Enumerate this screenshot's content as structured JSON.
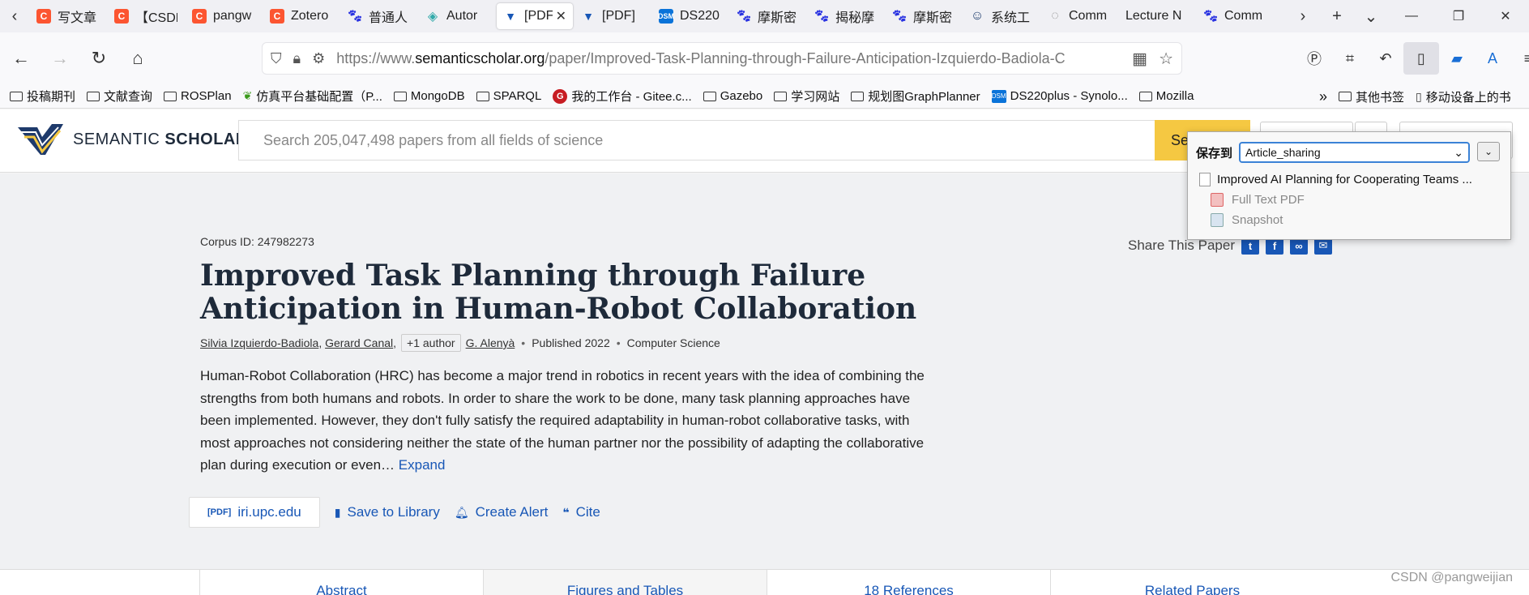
{
  "browser": {
    "tabs": [
      {
        "label": "写文章",
        "icon": "csdn-icon",
        "active": false
      },
      {
        "label": "【CSDN",
        "icon": "csdn-icon",
        "active": false
      },
      {
        "label": "pangw",
        "icon": "csdn-icon",
        "active": false
      },
      {
        "label": "Zotero",
        "icon": "csdn-icon",
        "active": false
      },
      {
        "label": "普通人",
        "icon": "baidu-paw-icon",
        "active": false
      },
      {
        "label": "Autor",
        "icon": "autor-icon",
        "active": false
      },
      {
        "label": "[PDF",
        "icon": "semantic-scholar-icon",
        "active": true
      },
      {
        "label": "[PDF]",
        "icon": "semantic-scholar-icon",
        "active": false
      },
      {
        "label": "DS220",
        "icon": "dsm-icon",
        "active": false
      },
      {
        "label": "摩斯密",
        "icon": "baidu-paw-icon",
        "active": false
      },
      {
        "label": "揭秘摩",
        "icon": "baidu-paw-icon",
        "active": false
      },
      {
        "label": "摩斯密",
        "icon": "baidu-paw-icon",
        "active": false
      },
      {
        "label": "系统工",
        "icon": "system-icon",
        "active": false
      },
      {
        "label": "Comm",
        "icon": "doc-icon",
        "active": false
      },
      {
        "label": "Lecture N",
        "icon": "",
        "active": false
      },
      {
        "label": "Comm",
        "icon": "baidu-paw-icon",
        "active": false
      }
    ],
    "url": {
      "prefix": "https://www.",
      "host": "semanticscholar.org",
      "path": "/paper/Improved-Task-Planning-through-Failure-Anticipation-Izquierdo-Badiola-C"
    },
    "bookmarks": [
      {
        "label": "投稿期刊",
        "icon": "folder"
      },
      {
        "label": "文献查询",
        "icon": "folder"
      },
      {
        "label": "ROSPlan",
        "icon": "folder"
      },
      {
        "label": "仿真平台基础配置（P...",
        "icon": "leaf"
      },
      {
        "label": "MongoDB",
        "icon": "folder"
      },
      {
        "label": "SPARQL",
        "icon": "folder"
      },
      {
        "label": "我的工作台 - Gitee.c...",
        "icon": "gitee"
      },
      {
        "label": "Gazebo",
        "icon": "folder"
      },
      {
        "label": "学习网站",
        "icon": "folder"
      },
      {
        "label": "规划图GraphPlanner",
        "icon": "folder"
      },
      {
        "label": "DS220plus - Synolo...",
        "icon": "dsm"
      },
      {
        "label": "Mozilla",
        "icon": "folder"
      }
    ],
    "bookmarks_overflow": [
      {
        "label": "其他书签",
        "icon": "folder"
      },
      {
        "label": "移动设备上的书",
        "icon": "mobile"
      }
    ]
  },
  "site": {
    "brand_light": "SEMANTIC ",
    "brand_bold": "SCHOLAR",
    "search_placeholder": "Search 205,047,498 papers from all fields of science",
    "search_button": "Se"
  },
  "paper": {
    "corpus_id": "Corpus ID: 247982273",
    "title": "Improved Task Planning through Failure Anticipation in Human-Robot Collaboration",
    "authors": [
      "Silvia Izquierdo-Badiola",
      "Gerard Canal"
    ],
    "more_authors": "+1 author",
    "last_author": "G. Alenyà",
    "published": "Published 2022",
    "field": "Computer Science",
    "abstract": "Human-Robot Collaboration (HRC) has become a major trend in robotics in recent years with the idea of combining the strengths from both humans and robots. In order to share the work to be done, many task planning approaches have been implemented. However, they don't fully satisfy the required adaptability in human-robot collaborative tasks, with most approaches not considering neither the state of the human partner nor the possibility of adapting the collaborative plan during execution or even…",
    "expand": "Expand",
    "share_label": "Share This Paper",
    "actions": {
      "pdf_tag": "[PDF]",
      "pdf_source": "iri.upc.edu",
      "save": "Save to Library",
      "alert": "Create Alert",
      "cite": "Cite"
    },
    "subnav": [
      "Abstract",
      "Figures and Tables",
      "18 References",
      "Related Papers"
    ]
  },
  "zotero": {
    "save_to_label": "保存到",
    "collection": "Article_sharing",
    "item_title": "Improved AI Planning for Cooperating Teams ...",
    "attachments": [
      "Full Text PDF",
      "Snapshot"
    ]
  },
  "watermark": "CSDN @pangweijian"
}
